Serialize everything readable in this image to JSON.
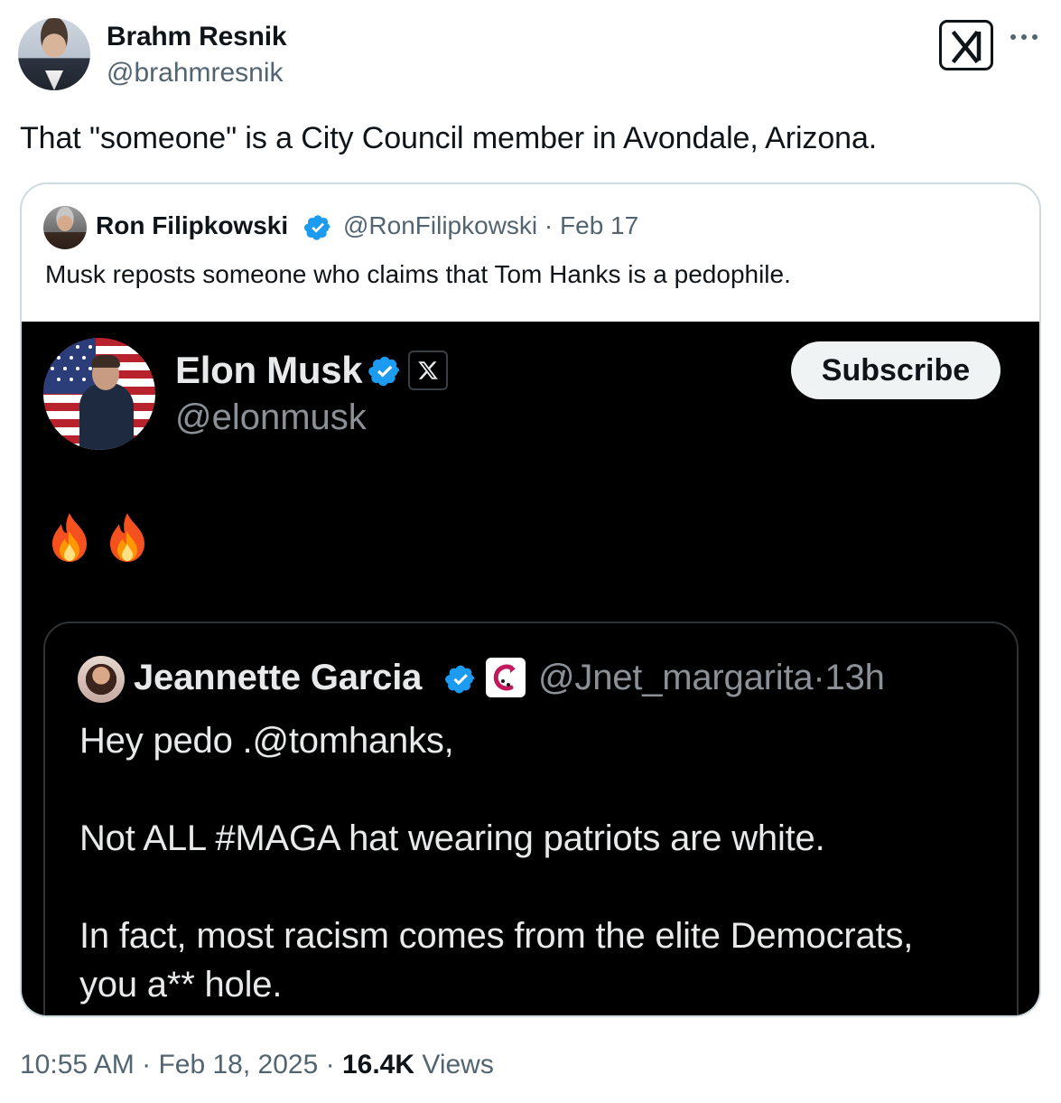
{
  "author": {
    "name": "Brahm Resnik",
    "handle": "@brahmresnik"
  },
  "tweet": {
    "text": "That \"someone\" is a City Council member in Avondale, Arizona."
  },
  "header_icons": {
    "logo": "xai-grok-logo",
    "menu": "more-options-icon"
  },
  "quote": {
    "name": "Ron Filipkowski",
    "handle": "@RonFilipkowski",
    "separator": "·",
    "date": "Feb 17",
    "text": "Musk reposts someone who claims that Tom Hanks is a pedophile."
  },
  "screenshot": {
    "name": "Elon Musk",
    "handle": "@elonmusk",
    "subscribe_label": "Subscribe",
    "emojis": [
      "fire-icon",
      "fire-icon"
    ],
    "inner": {
      "name": "Jeannette Garcia",
      "handle": "@Jnet_margarita",
      "separator": "·",
      "time": "13h",
      "line1": "Hey pedo .@tomhanks,",
      "line2": "Not ALL #MAGA hat wearing patriots are white.",
      "line3": "In fact,  most racism comes from the elite Democrats,",
      "line4": "you a** hole."
    }
  },
  "footer": {
    "time": "10:55 AM",
    "separator": "·",
    "date": "Feb 18, 2025",
    "views_count": "16.4K",
    "views_label": "Views"
  },
  "colors": {
    "verified": "#1d9bf0",
    "secondary_text": "#536471",
    "border": "#cfd9de"
  }
}
